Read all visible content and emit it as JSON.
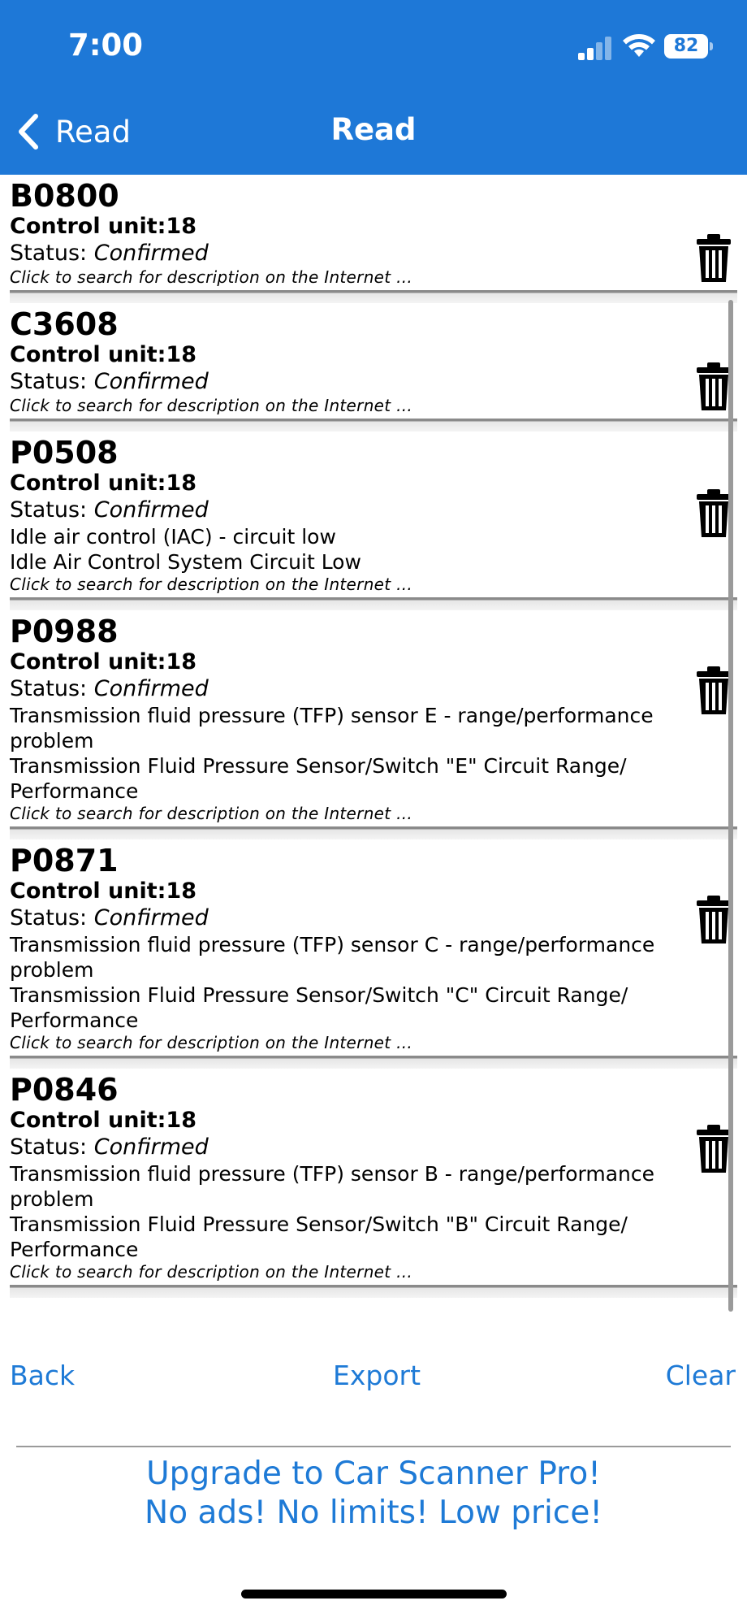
{
  "status_bar": {
    "time": "7:00",
    "battery": "82"
  },
  "nav": {
    "back_label": "Read",
    "title": "Read"
  },
  "codes": [
    {
      "code": "B0800",
      "control_unit": "Control unit:18",
      "status_prefix": "Status: ",
      "status": "Confirmed",
      "descriptions": [],
      "hint": "Click to search for description on the Internet ..."
    },
    {
      "code": "C3608",
      "control_unit": "Control unit:18",
      "status_prefix": "Status: ",
      "status": "Confirmed",
      "descriptions": [],
      "hint": "Click to search for description on the Internet ..."
    },
    {
      "code": "P0508",
      "control_unit": "Control unit:18",
      "status_prefix": "Status: ",
      "status": "Confirmed",
      "descriptions": [
        "Idle air control (IAC) - circuit low",
        "Idle Air Control System Circuit Low"
      ],
      "hint": "Click to search for description on the Internet ..."
    },
    {
      "code": "P0988",
      "control_unit": "Control unit:18",
      "status_prefix": "Status: ",
      "status": "Confirmed",
      "descriptions": [
        "Transmission fluid pressure (TFP) sensor E - range/performance problem",
        "Transmission Fluid Pressure Sensor/Switch \"E\" Circuit Range/ Performance"
      ],
      "hint": "Click to search for description on the Internet ..."
    },
    {
      "code": "P0871",
      "control_unit": "Control unit:18",
      "status_prefix": "Status: ",
      "status": "Confirmed",
      "descriptions": [
        "Transmission fluid pressure (TFP) sensor C - range/performance problem",
        "Transmission Fluid Pressure Sensor/Switch \"C\" Circuit Range/ Performance"
      ],
      "hint": "Click to search for description on the Internet ..."
    },
    {
      "code": "P0846",
      "control_unit": "Control unit:18",
      "status_prefix": "Status: ",
      "status": "Confirmed",
      "descriptions": [
        "Transmission fluid pressure (TFP) sensor B - range/performance problem",
        "Transmission Fluid Pressure Sensor/Switch \"B\" Circuit Range/ Performance"
      ],
      "hint": "Click to search for description on the Internet ..."
    }
  ],
  "actions": {
    "back": "Back",
    "export": "Export",
    "clear": "Clear"
  },
  "promo": {
    "line1": "Upgrade to Car Scanner Pro!",
    "line2": "No ads! No limits! Low price!"
  },
  "colors": {
    "header": "#1e78d7",
    "link": "#1e7ad6"
  },
  "icons": {
    "back": "chevron-left-icon",
    "delete": "trash-icon",
    "signal": "cellular-signal-icon",
    "wifi": "wifi-icon",
    "battery": "battery-icon"
  }
}
